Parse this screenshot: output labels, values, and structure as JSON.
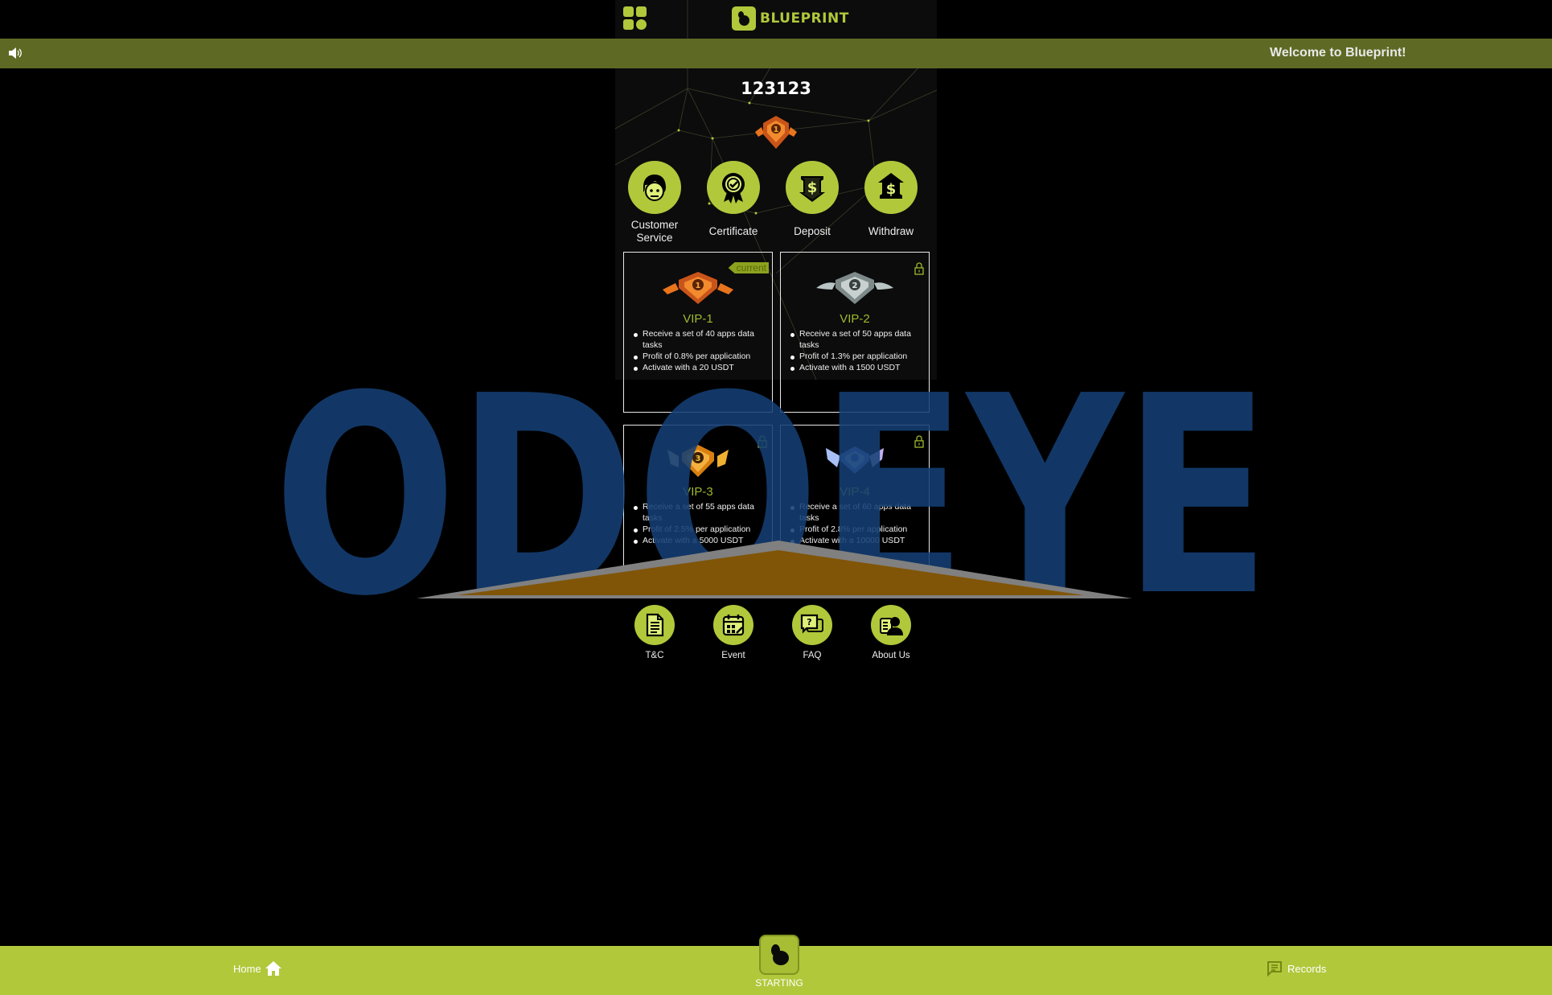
{
  "header": {
    "brand_name": "BLUEPRINT",
    "menu_icon": "grid-menu-icon"
  },
  "marquee": {
    "icon": "speaker-icon",
    "text": "Welcome to Blueprint!"
  },
  "profile": {
    "username": "123123",
    "current_level": 1
  },
  "actions": [
    {
      "label": "Customer Service",
      "icon": "headset-agent-icon"
    },
    {
      "label": "Certificate",
      "icon": "certificate-badge-icon"
    },
    {
      "label": "Deposit",
      "icon": "deposit-dollar-icon"
    },
    {
      "label": "Withdraw",
      "icon": "withdraw-dollar-icon"
    }
  ],
  "vip_levels": [
    {
      "title": "VIP-1",
      "status": "current",
      "status_label": "current",
      "badge_color": "#e8741d",
      "features": [
        "Receive a set of 40 apps data tasks",
        "Profit of 0.8% per application",
        "Activate with a 20 USDT"
      ]
    },
    {
      "title": "VIP-2",
      "status": "locked",
      "badge_color": "#b9c4c4",
      "features": [
        "Receive a set of 50 apps data tasks",
        "Profit of 1.3% per application",
        "Activate with a 1500 USDT"
      ]
    },
    {
      "title": "VIP-3",
      "status": "locked",
      "badge_color": "#f0a020",
      "features": [
        "Receive a set of 55 apps data tasks",
        "Profit of 2.5% per application",
        "Activate with a 5000 USDT"
      ]
    },
    {
      "title": "VIP-4",
      "status": "locked",
      "badge_color": "#8fb0f0",
      "features": [
        "Receive a set of 60 apps data tasks",
        "Profit of 2.8% per application",
        "Activate with a 10000 USDT"
      ]
    }
  ],
  "links": [
    {
      "label": "T&C",
      "icon": "document-icon"
    },
    {
      "label": "Event",
      "icon": "calendar-icon"
    },
    {
      "label": "FAQ",
      "icon": "faq-chat-icon"
    },
    {
      "label": "About Us",
      "icon": "about-profile-icon"
    }
  ],
  "watermark": {
    "text": "ODOEYE"
  },
  "bottom_nav": {
    "home": "Home",
    "start": "STARTING",
    "records": "Records"
  },
  "colors": {
    "accent": "#b1c83b",
    "marquee_bg": "#5e6a24",
    "vip_title": "#9eb82e",
    "watermark_blue": "#153f74",
    "watermark_gold": "#7f5200"
  }
}
